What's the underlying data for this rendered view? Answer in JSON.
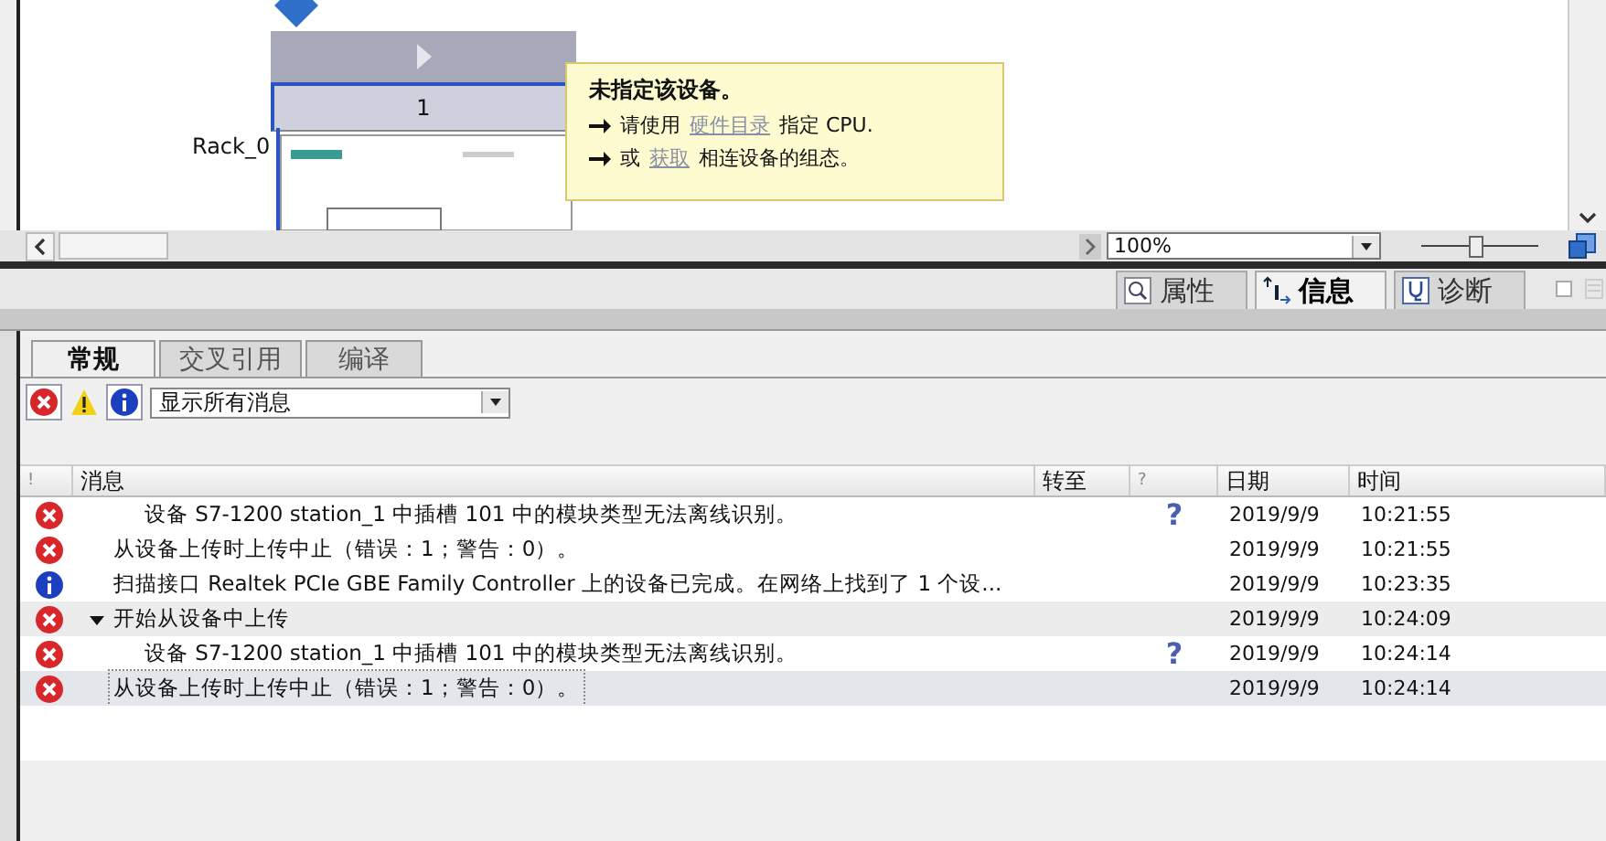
{
  "canvas": {
    "rack_label": "Rack_0",
    "slot_label": "1"
  },
  "tooltip": {
    "title": "未指定该设备。",
    "lines": [
      {
        "before": "请使用",
        "link": "硬件目录",
        "after": "指定 CPU."
      },
      {
        "before": "或",
        "link": "获取",
        "after": "相连设备的组态。"
      }
    ]
  },
  "zoom": {
    "value": "100%",
    "level": 0.45
  },
  "inspector_tabs": [
    {
      "label": "属性",
      "selected": false
    },
    {
      "label": "信息",
      "selected": true
    },
    {
      "label": "诊断",
      "selected": false
    }
  ],
  "sub_tabs": [
    {
      "label": "常规",
      "selected": true
    },
    {
      "label": "交叉引用",
      "selected": false
    },
    {
      "label": "编译",
      "selected": false
    }
  ],
  "filter": {
    "value": "显示所有消息"
  },
  "columns": [
    "!",
    "消息",
    "转至",
    "?",
    "日期",
    "时间"
  ],
  "messages": [
    {
      "children": [
        {
          "kind": "error",
          "message": "设备 S7-1200 station_1 中插槽 101 中的模块类型无法离线识别。",
          "help": "?",
          "date": "2019/9/9",
          "time": "10:21:55",
          "selected": false
        }
      ]
    },
    {
      "kind": "error",
      "message": "从设备上传时上传中止（错误：1；警告：0）。",
      "date": "2019/9/9",
      "time": "10:21:55",
      "selected": false
    },
    {
      "kind": "info",
      "message": "扫描接口 Realtek PCIe GBE Family Controller 上的设备已完成。在网络上找到了 1 个设...",
      "date": "2019/9/9",
      "time": "10:23:35",
      "selected": false
    },
    {
      "kind": "error",
      "message": "开始从设备中上传",
      "date": "2019/9/9",
      "time": "10:24:09",
      "selected": false,
      "expanded": true,
      "children": [
        {
          "kind": "error",
          "message": "设备 S7-1200 station_1 中插槽 101 中的模块类型无法离线识别。",
          "help": "?",
          "date": "2019/9/9",
          "time": "10:24:14",
          "selected": false
        }
      ]
    },
    {
      "kind": "error",
      "message": "从设备上传时上传中止（错误：1；警告：0）。",
      "date": "2019/9/9",
      "time": "10:24:14",
      "selected": true
    }
  ]
}
